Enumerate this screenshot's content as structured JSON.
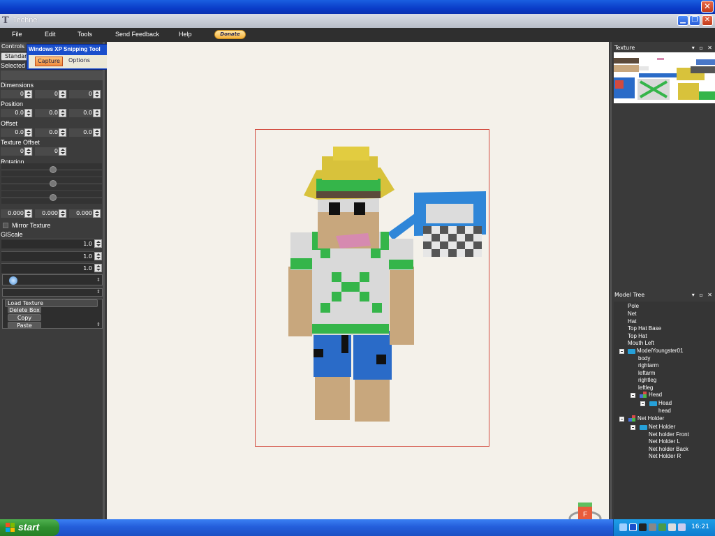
{
  "app": {
    "title": "Techne"
  },
  "menu": {
    "file": "File",
    "edit": "Edit",
    "tools": "Tools",
    "send_feedback": "Send Feedback",
    "help": "Help",
    "donate": "Donate"
  },
  "controls": {
    "tab": "Controls",
    "standard_button": "Standar",
    "selected_label": "Selected C",
    "dimensions_label": "Dimensions",
    "dimensions": [
      "0",
      "0",
      "0"
    ],
    "position_label": "Position",
    "position": [
      "0.0",
      "0.0",
      "0.0"
    ],
    "offset_label": "Offset",
    "offset": [
      "0.0",
      "0.0",
      "0.0"
    ],
    "texture_offset_label": "Texture Offset",
    "texture_offset": [
      "0",
      "0"
    ],
    "rotation_label": "Rotation",
    "rotation_values": [
      "0.000",
      "0.000",
      "0.000"
    ],
    "mirror_texture": "Mirror Texture",
    "glscale_label": "GlScale",
    "glscale": [
      "1.0",
      "1.0",
      "1.0"
    ],
    "load_texture": "Load Texture",
    "delete_box": "Delete Box",
    "copy": "Copy",
    "paste": "Paste"
  },
  "snipping_tool": {
    "title": "Windows XP Snipping Tool",
    "capture": "Capture",
    "options": "Options"
  },
  "texture_panel": {
    "title": "Texture"
  },
  "model_tree": {
    "title": "Model Tree",
    "items": [
      {
        "label": "Pole"
      },
      {
        "label": "Net"
      },
      {
        "label": "Hat"
      },
      {
        "label": "Top Hat Base"
      },
      {
        "label": "Top Hat"
      },
      {
        "label": "Mouth Left"
      },
      {
        "label": "ModelYoungster01"
      },
      {
        "label": "body"
      },
      {
        "label": "rightarm"
      },
      {
        "label": "leftarm"
      },
      {
        "label": "rightleg"
      },
      {
        "label": "leftleg"
      },
      {
        "label": "Head"
      },
      {
        "label": "Head"
      },
      {
        "label": "head"
      },
      {
        "label": "Net Holder"
      },
      {
        "label": "Net Holder"
      },
      {
        "label": "Net holder Front"
      },
      {
        "label": "Net Holder L"
      },
      {
        "label": "Net holder Back"
      },
      {
        "label": "Net Holder R"
      }
    ]
  },
  "taskbar": {
    "start": "start",
    "clock": "16:21"
  },
  "gizmo": {
    "label": "F"
  },
  "colors": {
    "skin": "#c8a77d",
    "hat": "#d8c23b",
    "hat_band": "#35b54a",
    "shirt": "#d9d9d9",
    "pants": "#2a6bc8",
    "net": "#2f86d8"
  }
}
